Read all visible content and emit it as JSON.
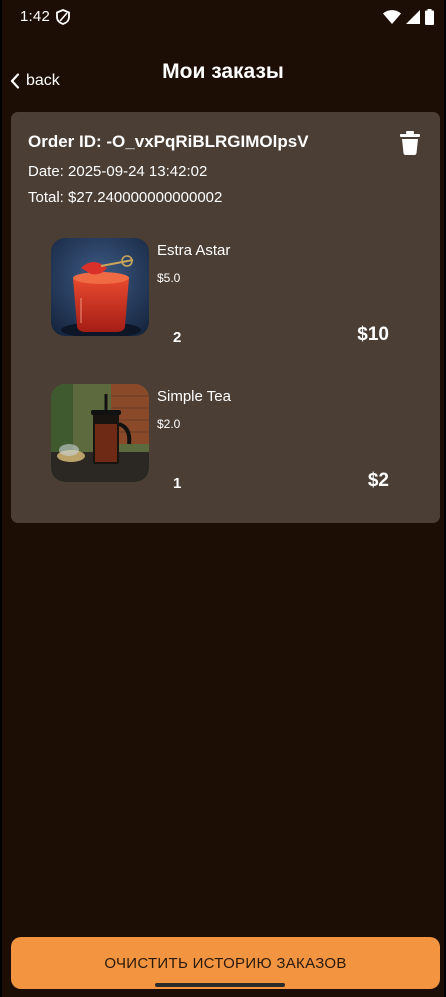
{
  "status_bar": {
    "time": "1:42",
    "icons": [
      "shield-icon",
      "wifi-icon",
      "signal-icon",
      "battery-icon"
    ]
  },
  "header": {
    "back_label": "back",
    "title": "Мои заказы"
  },
  "order": {
    "order_id": "Order ID: -O_vxPqRiBLRGIMOlpsV",
    "date": "Date: 2025-09-24 13:42:02",
    "total": "Total: $27.240000000000002",
    "items": [
      {
        "name": "Estra Astar",
        "price": "$5.0",
        "quantity": "2",
        "subtotal": "$10",
        "image": "red-cocktail"
      },
      {
        "name": "Simple Tea",
        "price": "$2.0",
        "quantity": "1",
        "subtotal": "$2",
        "image": "tea-press"
      }
    ]
  },
  "footer": {
    "clear_button_label": "ОЧИСТИТЬ ИСТОРИЮ ЗАКАЗОВ"
  },
  "colors": {
    "background": "#1d0e05",
    "card": "#4b3e35",
    "accent": "#f29440"
  }
}
